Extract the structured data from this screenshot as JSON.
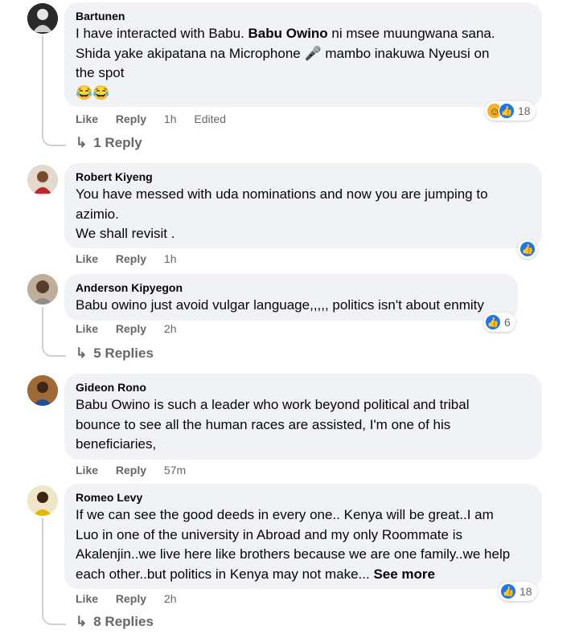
{
  "comments": [
    {
      "author": "Bartunen",
      "text_lines": [
        [
          "I have interacted with Babu. ",
          "Babu Owino",
          " ni msee muungwana sana."
        ],
        "Shida yake akipatana na Microphone 🎤 mambo inakuwa Nyeusi on",
        "the spot",
        "😂😂"
      ],
      "like": "Like",
      "reply": "Reply",
      "time": "1h",
      "edited": "Edited",
      "reaction_count": "18",
      "reactions": [
        "haha-icon",
        "like-icon"
      ],
      "replies": "1 Reply"
    },
    {
      "author": "Robert Kiyeng",
      "text_lines": [
        "You have messed with uda nominations and now you are jumping to",
        "azimio.",
        "We shall revisit ."
      ],
      "like": "Like",
      "reply": "Reply",
      "time": "1h",
      "reactions": [
        "like-icon"
      ]
    },
    {
      "author": "Anderson Kipyegon",
      "text_lines": [
        "Babu owino just avoid vulgar language,,,,, politics isn't about enmity"
      ],
      "like": "Like",
      "reply": "Reply",
      "time": "2h",
      "reaction_count": "6",
      "reactions": [
        "like-icon"
      ],
      "replies": "5 Replies"
    },
    {
      "author": "Gideon Rono",
      "text_lines": [
        "Babu Owino is such a leader who work beyond political and tribal",
        "bounce to see all the human races are assisted, I'm one of his",
        "beneficiaries,"
      ],
      "like": "Like",
      "reply": "Reply",
      "time": "57m"
    },
    {
      "author": "Romeo Levy",
      "text_lines": [
        "If we can see the good deeds in every one.. Kenya will be great..I am",
        "Luo in one of the university in Abroad and my only Roommate is",
        "Akalenjin..we live here like brothers because we are one family..we help",
        "each other..but politics in Kenya may not make..."
      ],
      "see_more": "See more",
      "like": "Like",
      "reply": "Reply",
      "time": "2h",
      "reaction_count": "18",
      "reactions": [
        "like-icon"
      ],
      "replies": "8 Replies"
    }
  ],
  "icons": {
    "reply_arrow": "reply-arrow-icon",
    "like_reaction": "thumbs-up",
    "haha_reaction": "laughing-face"
  },
  "colors": {
    "bubble": "#f0f2f5",
    "meta_text": "#65676b",
    "like_blue": "#1877f2"
  }
}
